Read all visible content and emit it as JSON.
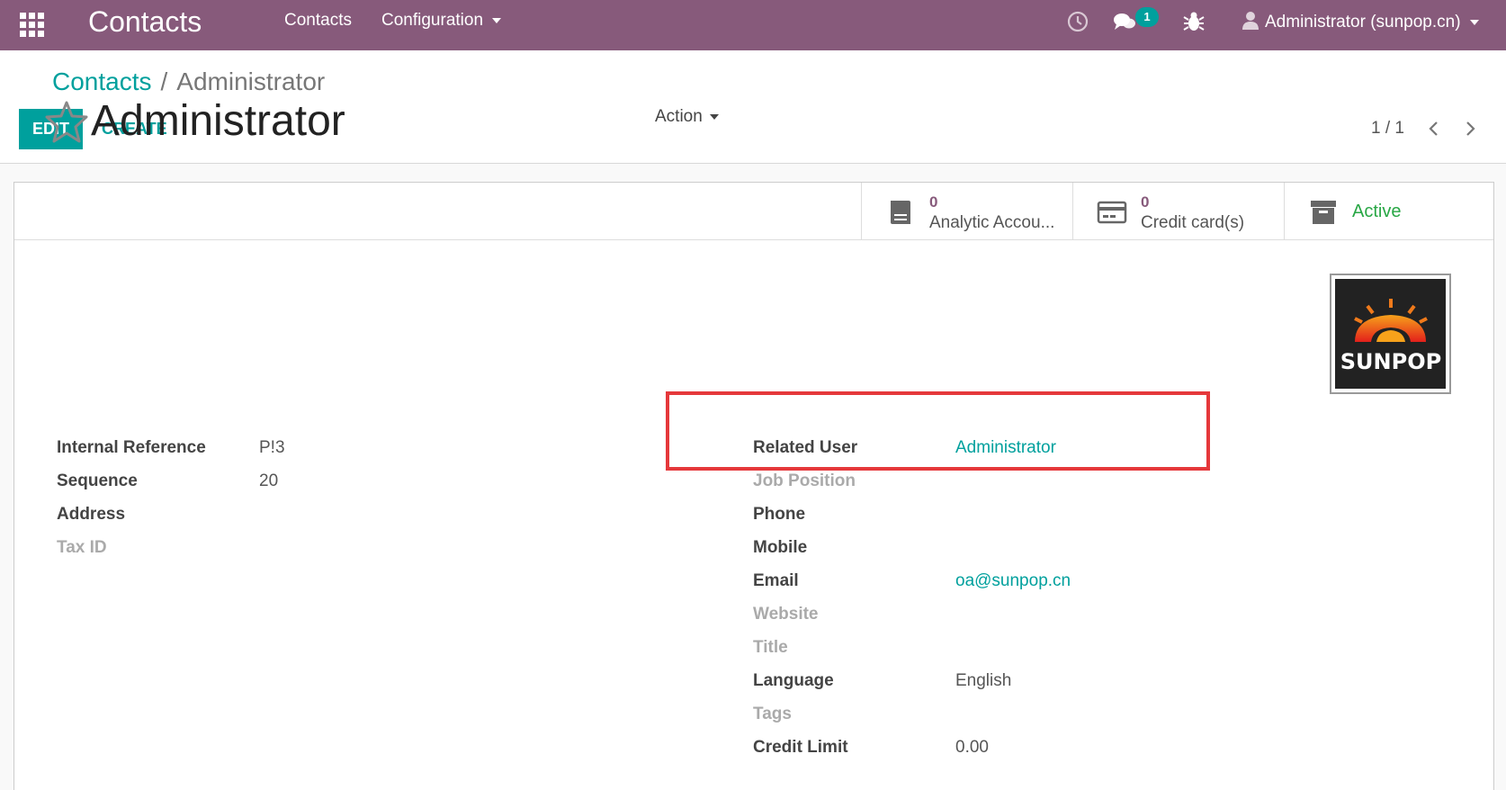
{
  "navbar": {
    "brand": "Contacts",
    "menus": [
      "Contacts",
      "Configuration"
    ],
    "message_count": "1",
    "user": "Administrator (sunpop.cn)"
  },
  "breadcrumb": {
    "parent": "Contacts",
    "separator": "/",
    "current": "Administrator"
  },
  "toolbar": {
    "edit": "EDIT",
    "create": "CREATE",
    "action": "Action",
    "pager": "1 / 1"
  },
  "stat_buttons": [
    {
      "value": "0",
      "label": "Analytic Accou...",
      "icon": "book-icon"
    },
    {
      "value": "0",
      "label": "Credit card(s)",
      "icon": "credit-card-icon"
    },
    {
      "value": "",
      "label": "Active",
      "icon": "archive-icon"
    }
  ],
  "record": {
    "name": "Administrator",
    "avatar_text": "SUNPOP"
  },
  "left_fields": [
    {
      "label": "Internal Reference",
      "value": "P!3",
      "muted": false
    },
    {
      "label": "Sequence",
      "value": "20",
      "muted": false
    },
    {
      "label": "Address",
      "value": "",
      "muted": false
    },
    {
      "label": "Tax ID",
      "value": "",
      "muted": true
    }
  ],
  "right_fields": [
    {
      "label": "Related User",
      "value": "Administrator",
      "muted": false,
      "link": true
    },
    {
      "label": "Job Position",
      "value": "",
      "muted": true
    },
    {
      "label": "Phone",
      "value": "",
      "muted": false
    },
    {
      "label": "Mobile",
      "value": "",
      "muted": false
    },
    {
      "label": "Email",
      "value": "oa@sunpop.cn",
      "muted": false,
      "link": true
    },
    {
      "label": "Website",
      "value": "",
      "muted": true
    },
    {
      "label": "Title",
      "value": "",
      "muted": true
    },
    {
      "label": "Language",
      "value": "English",
      "muted": false
    },
    {
      "label": "Tags",
      "value": "",
      "muted": true
    },
    {
      "label": "Credit Limit",
      "value": "0.00",
      "muted": false
    }
  ],
  "colors": {
    "navbar": "#875a7b",
    "accent": "#00a09d",
    "active": "#28a745",
    "highlight": "#e5383b"
  }
}
